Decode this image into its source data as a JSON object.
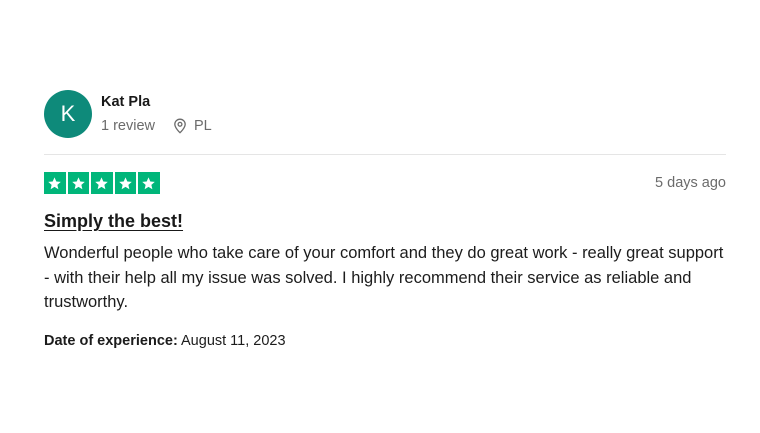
{
  "review": {
    "consumer": {
      "avatar_initial": "K",
      "name": "Kat Pla",
      "review_count": "1 review",
      "location": "PL",
      "location_icon": "map-pin-icon"
    },
    "rating": {
      "stars": 5,
      "max_stars": 5,
      "star_icon": "star-icon"
    },
    "date": "5 days ago",
    "title": "Simply the best!",
    "body": "Wonderful people who take care of your comfort and they do great work - really great support - with their help all my issue was solved. I highly recommend their service as reliable and trustworthy.",
    "experience_label": "Date of experience:",
    "experience_date": "August 11, 2023"
  },
  "colors": {
    "avatar_bg": "#0e8a7a",
    "star_bg": "#00b67a",
    "text_primary": "#191919",
    "text_secondary": "#6b6b6b",
    "divider": "#e5e5e5"
  }
}
